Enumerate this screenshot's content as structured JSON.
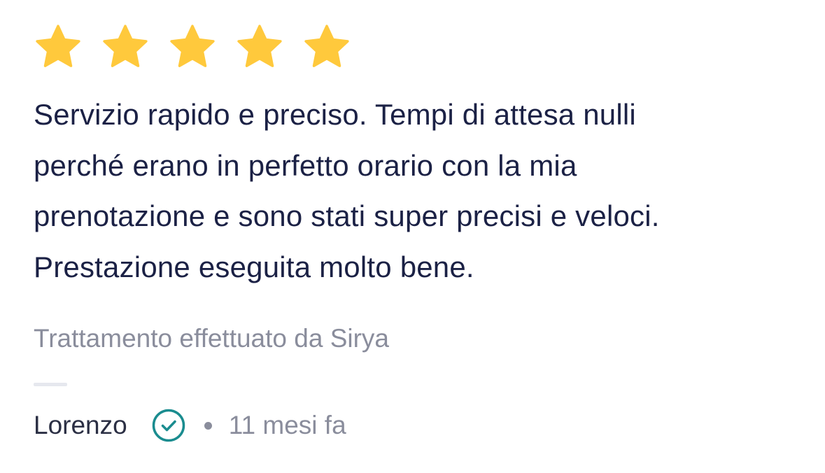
{
  "review": {
    "rating": 5,
    "max_rating": 5,
    "star_color": "#FFC93C",
    "text_lines": [
      "Servizio rapido e preciso. Tempi di attesa nulli",
      "perché erano in perfetto orario con la mia",
      "prenotazione e sono stati super precisi e veloci.",
      "Prestazione eseguita molto bene."
    ],
    "treatment": "Trattamento effettuato da Sirya",
    "author": "Lorenzo",
    "verified_icon": "check-circle-icon",
    "verified_color": "#1a8c8f",
    "time_ago": "11 mesi fa"
  }
}
